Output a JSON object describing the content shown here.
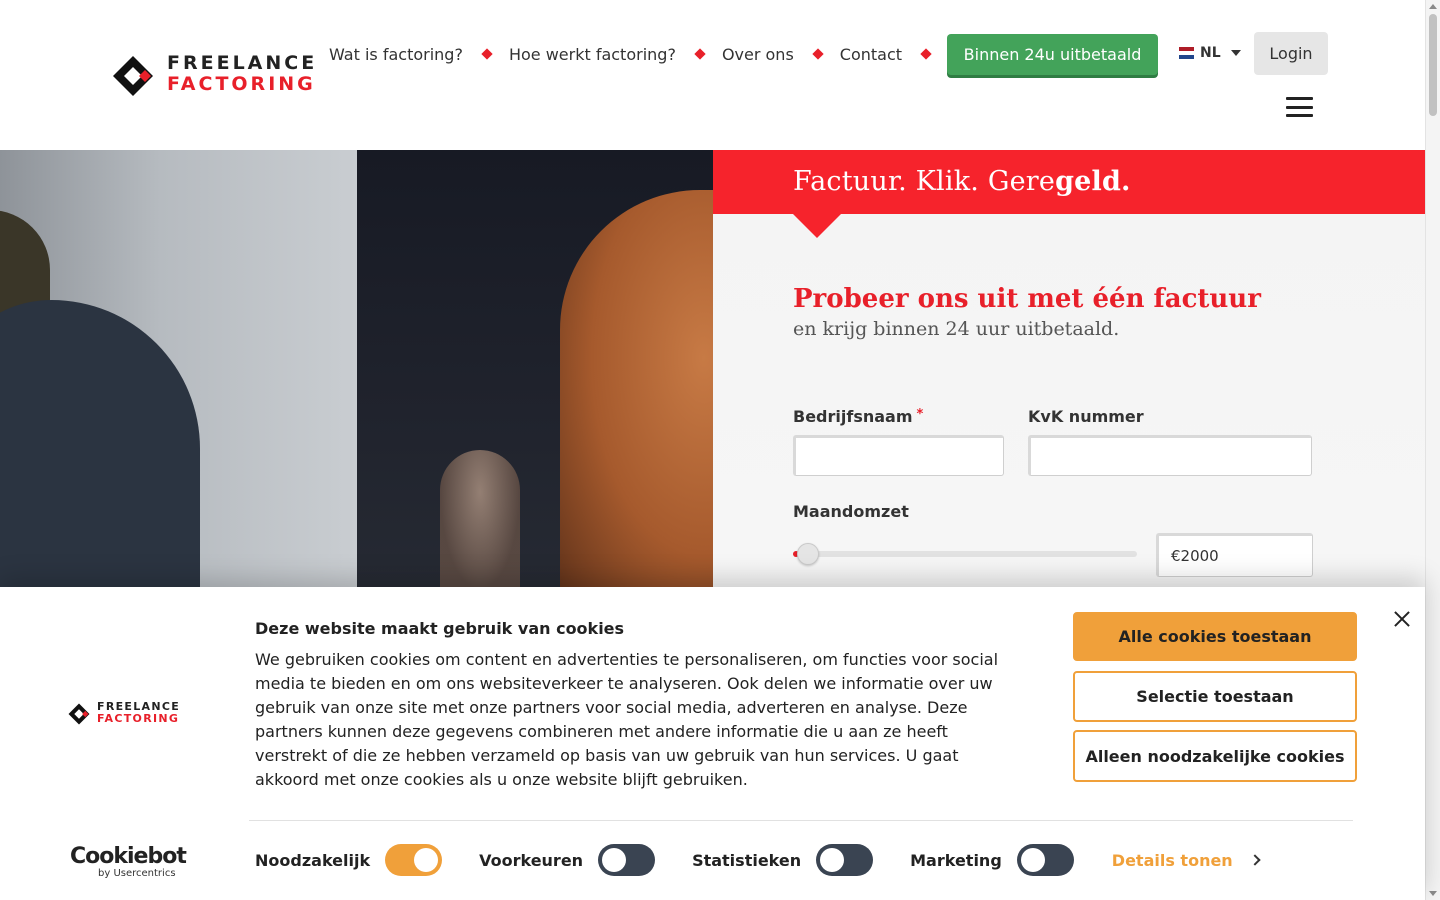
{
  "header": {
    "logo": {
      "line1": "FREELANCE",
      "line2": "FACTORING"
    },
    "nav": [
      {
        "label": "Wat is factoring?"
      },
      {
        "label": "Hoe werkt factoring?"
      },
      {
        "label": "Over ons"
      },
      {
        "label": "Contact"
      }
    ],
    "cta_label": "Binnen 24u uitbetaald",
    "language": "NL",
    "login_label": "Login"
  },
  "hero": {
    "slogan_plain": "Factuur. Klik. Gere",
    "slogan_bold": "geld.",
    "form_title": "Probeer ons uit met één factuur",
    "form_subtitle": "en krijg binnen 24 uur uitbetaald.",
    "fields": {
      "company_label": "Bedrijfsnaam",
      "company_required": "*",
      "company_value": "",
      "kvk_label": "KvK nummer",
      "kvk_value": "",
      "revenue_label": "Maandomzet",
      "revenue_amount": "2000",
      "currency_symbol": "€",
      "revenue_slider_fraction": 0.0
    }
  },
  "cookie_banner": {
    "logo": {
      "line1": "FREELANCE",
      "line2": "FACTORING"
    },
    "title": "Deze website maakt gebruik van cookies",
    "text": "We gebruiken cookies om content en advertenties te personaliseren, om functies voor social media te bieden en om ons websiteverkeer te analyseren. Ook delen we informatie over uw gebruik van onze site met onze partners voor social media, adverteren en analyse. Deze partners kunnen deze gegevens combineren met andere informatie die u aan ze heeft verstrekt of die ze hebben verzameld op basis van uw gebruik van hun services. U gaat akkoord met onze cookies als u onze website blijft gebruiken.",
    "buttons": {
      "allow_all": "Alle cookies toestaan",
      "allow_selection": "Selectie toestaan",
      "necessary_only": "Alleen noodzakelijke cookies"
    },
    "toggles": [
      {
        "label": "Noodzakelijk",
        "state": "on"
      },
      {
        "label": "Voorkeuren",
        "state": "off"
      },
      {
        "label": "Statistieken",
        "state": "off"
      },
      {
        "label": "Marketing",
        "state": "off"
      }
    ],
    "details_label": "Details tonen",
    "brand": {
      "name": "Cookiebot",
      "by": "by Usercentrics"
    }
  },
  "colors": {
    "brand_red": "#e8202a",
    "band_red": "#f6232c",
    "cta_green": "#43a35a",
    "cookie_orange": "#f0a03a",
    "toggle_off": "#3a4452"
  },
  "icons": [
    "logo-diamond-icon",
    "nav-separator-diamond-icon",
    "nl-flag-icon",
    "caret-down-icon",
    "hamburger-menu-icon",
    "close-icon",
    "chevron-right-icon"
  ]
}
